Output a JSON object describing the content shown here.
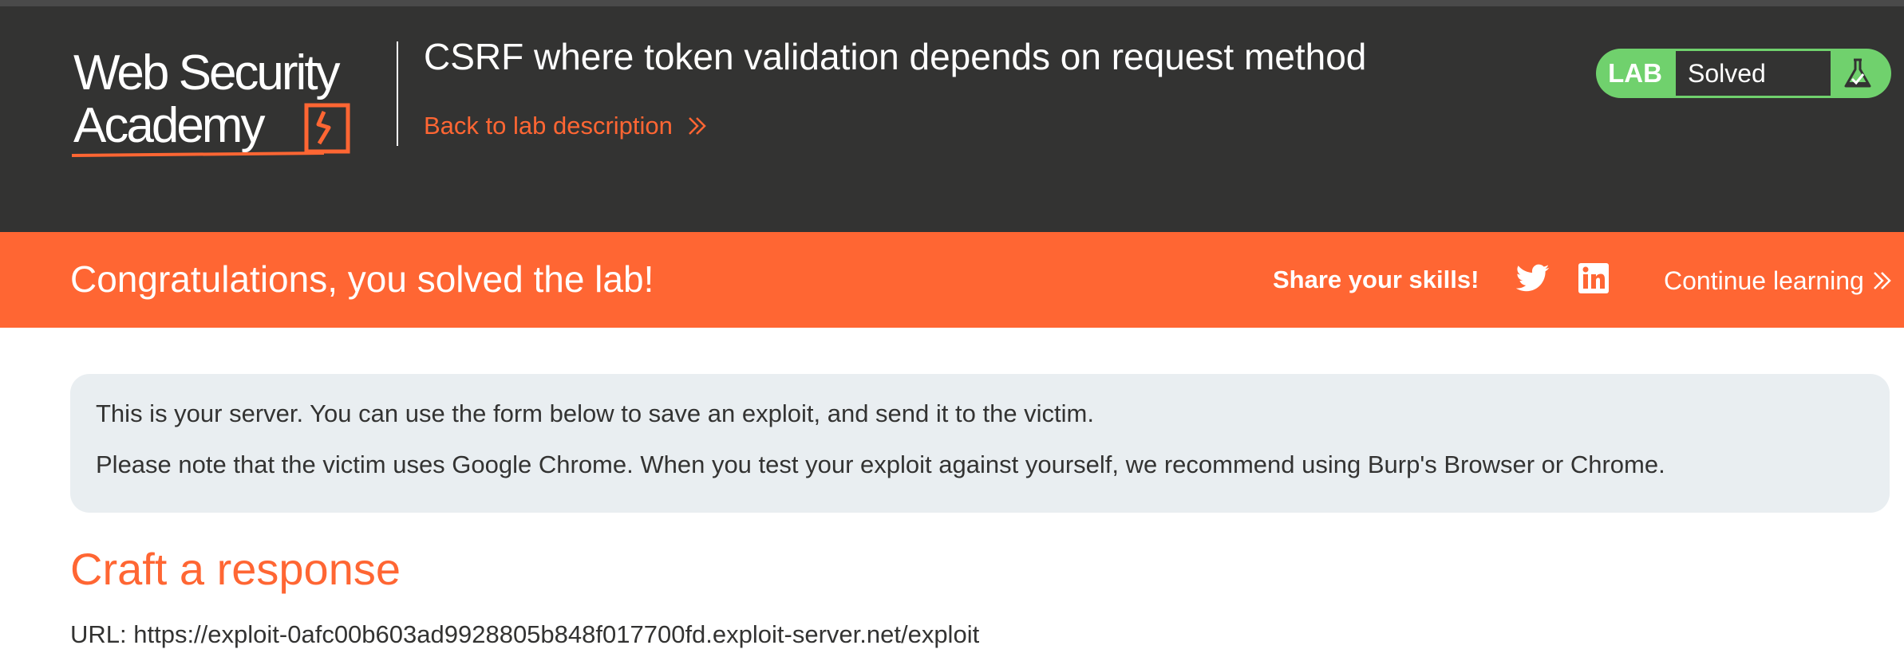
{
  "header": {
    "logo_line1": "Web Security",
    "logo_line2": "Academy",
    "lab_title": "CSRF where token validation depends on request method",
    "back_link": "Back to lab description"
  },
  "status": {
    "badge": "LAB",
    "state": "Solved",
    "icon": "flask-check-icon",
    "color": "#70d16d"
  },
  "banner": {
    "message": "Congratulations, you solved the lab!",
    "share_label": "Share your skills!",
    "social_icons": [
      "twitter-icon",
      "linkedin-icon"
    ],
    "continue_label": "Continue learning",
    "color": "#ff6633"
  },
  "notice": {
    "line1": "This is your server. You can use the form below to save an exploit, and send it to the victim.",
    "line2": "Please note that the victim uses Google Chrome. When you test your exploit against yourself, we recommend using Burp's Browser or Chrome."
  },
  "section": {
    "heading": "Craft a response",
    "url_line": "URL: https://exploit-0afc00b603ad9928805b848f017700fd.exploit-server.net/exploit"
  }
}
